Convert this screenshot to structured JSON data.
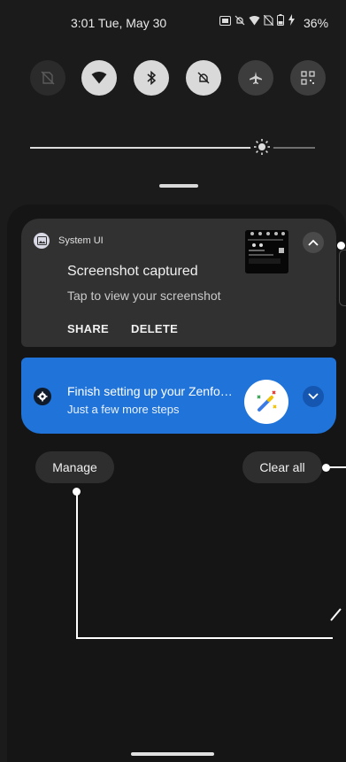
{
  "status_bar": {
    "time_date": "3:01 Tue, May 30",
    "battery": "36%"
  },
  "quick_tiles": [
    {
      "name": "mobile-data-off",
      "icon": "no-sim-icon",
      "state": "off"
    },
    {
      "name": "wifi",
      "icon": "wifi-icon",
      "state": "on"
    },
    {
      "name": "bluetooth",
      "icon": "bluetooth-icon",
      "state": "on"
    },
    {
      "name": "sound",
      "icon": "bell-off-icon",
      "state": "on"
    },
    {
      "name": "airplane",
      "icon": "airplane-icon",
      "state": "off"
    },
    {
      "name": "qr-scanner",
      "icon": "qr-code-icon",
      "state": "off"
    }
  ],
  "brightness": {
    "level": 0.8
  },
  "notifications": [
    {
      "app_name": "System UI",
      "title": "Screenshot captured",
      "text": "Tap to view your screenshot",
      "actions": [
        "SHARE",
        "DELETE"
      ]
    },
    {
      "title": "Finish setting up your Zenfo…",
      "text": "Just a few more steps",
      "accent": "#1f73d9"
    }
  ],
  "buttons": {
    "manage": "Manage",
    "clear_all": "Clear all"
  },
  "colors": {
    "background": "#1b1b1b",
    "card": "#313131",
    "accent_blue": "#1f73d9"
  }
}
